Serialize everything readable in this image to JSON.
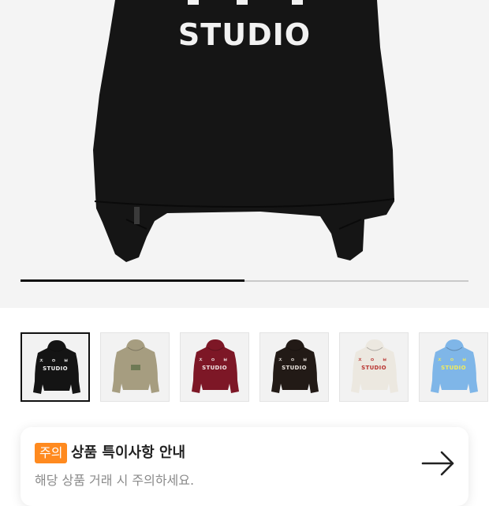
{
  "hero": {
    "print_text": "STUDIO",
    "garment_color": "#151515",
    "background": "#f4f4f4"
  },
  "gallery": {
    "progress": 0.5,
    "selected_index": 0
  },
  "thumbnails": [
    {
      "color": "#141414",
      "print_color": "#f2f2f2",
      "print_text": "STUDIO",
      "dots": "ㅈ ㅇ ㅂ"
    },
    {
      "color": "#a69d80",
      "print_color": "#6e7a55",
      "print_text": "",
      "dots": ""
    },
    {
      "color": "#7d1726",
      "print_color": "#f2e6e6",
      "print_text": "STUDIO",
      "dots": "ㅈ ㅇ ㅂ"
    },
    {
      "color": "#221a16",
      "print_color": "#e9e2dc",
      "print_text": "STUDIO",
      "dots": "ㅈ ㅇ ㅂ"
    },
    {
      "color": "#ece8e0",
      "print_color": "#b8332f",
      "print_text": "STUDIO",
      "dots": "ㅈ ㅇ ㅂ"
    },
    {
      "color": "#7fb6e8",
      "print_color": "#f3ec5a",
      "print_text": "STUDIO",
      "dots": "ㅈ ㅇ ㅂ"
    }
  ],
  "notice": {
    "badge": "주의",
    "title": "상품 특이사항 안내",
    "description": "해당 상품 거래 시 주의하세요.",
    "arrow_icon": "arrow-right-icon",
    "badge_color": "#ff8a1f"
  }
}
